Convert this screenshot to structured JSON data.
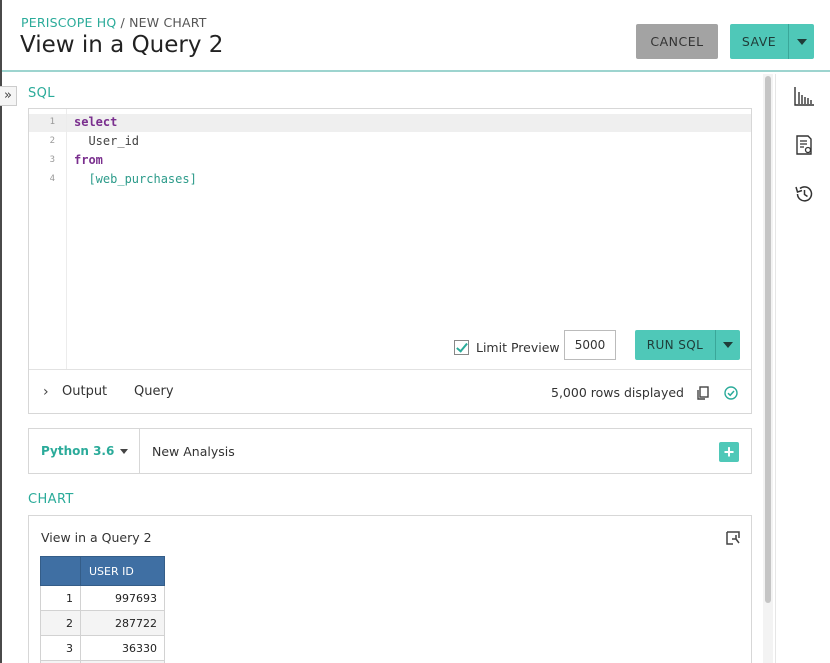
{
  "header": {
    "breadcrumb_root": "PERISCOPE HQ",
    "breadcrumb_sep": " / ",
    "breadcrumb_current": "NEW CHART",
    "title": "View in a Query 2",
    "cancel_label": "CANCEL",
    "save_label": "SAVE"
  },
  "sql": {
    "section_label": "SQL",
    "line_numbers": [
      "1",
      "2",
      "3",
      "4"
    ],
    "lines": [
      "select",
      "  User_id",
      "from",
      "  [web_purchases]"
    ],
    "limit_label": "Limit Preview",
    "limit_checked": true,
    "limit_value": "5000",
    "run_label": "RUN SQL",
    "output_tab": "Output",
    "query_tab": "Query",
    "rows_displayed": "5,000 rows displayed"
  },
  "python": {
    "version": "Python 3.6",
    "analysis_name": "New Analysis",
    "add_symbol": "+"
  },
  "chart": {
    "section_label": "CHART",
    "title": "View in a Query 2",
    "table": {
      "columns": [
        "",
        "USER ID"
      ],
      "rows": [
        [
          "1",
          "997693"
        ],
        [
          "2",
          "287722"
        ],
        [
          "3",
          "36330"
        ]
      ]
    }
  },
  "icons": {
    "sidebar_toggle": "»",
    "expand": "›"
  },
  "colors": {
    "accent": "#4fc8b8",
    "accent_text": "#2bab9a",
    "table_header": "#3f6fa3",
    "cancel_bg": "#a3a3a3"
  }
}
